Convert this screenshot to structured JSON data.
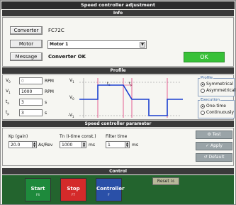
{
  "window": {
    "title": "Speed controller adjustment"
  },
  "info": {
    "header": "Info",
    "converter_button": "Converter",
    "converter_value": "FC72C",
    "motor_button": "Motor",
    "motor_value": "Motor 1",
    "message_button": "Message",
    "message_value": "Converter OK",
    "ok_label": "OK"
  },
  "profile": {
    "header": "Profile",
    "fields": [
      {
        "sym": "V",
        "sub": "0",
        "value": "0",
        "unit": "RPM"
      },
      {
        "sym": "V",
        "sub": "1",
        "value": "1000",
        "unit": "RPM"
      },
      {
        "sym": "t",
        "sub": "a",
        "value": "3",
        "unit": "s"
      },
      {
        "sym": "t",
        "sub": "p",
        "value": "3",
        "unit": "s"
      }
    ],
    "graph": {
      "v1_sym": "V",
      "v1_sub": "1",
      "v0_sym": "V",
      "v0_sub": "0",
      "negv1_sym": "-V",
      "negv1_sub": "1",
      "ta_sym": "t",
      "ta_sub": "a",
      "tp_sym": "t",
      "tp_sub": "p"
    },
    "profile_group": {
      "title": "Profile",
      "options": [
        "Symmetrical",
        "Asymmetrical"
      ],
      "selected": "Symmetrical"
    },
    "execution_group": {
      "title": "Execution",
      "options": [
        "One-time",
        "Continuously"
      ],
      "selected": "One-time"
    }
  },
  "controller": {
    "header": "Speed controller parameter",
    "kp_label": "Kp (gain)",
    "kp_value": "20.0",
    "kp_unit": "As/Rev",
    "tn_label": "Tn (I-time const.)",
    "tn_value": "1000",
    "tn_unit": "ms",
    "filter_label": "Filter time",
    "filter_value": "1",
    "filter_unit": "ms",
    "test_label": "Test",
    "apply_label": "Apply",
    "default_label": "Default"
  },
  "control": {
    "header": "Control",
    "start": {
      "label": "Start",
      "sub": "F4"
    },
    "stop": {
      "label": "Stop",
      "sub": "F7"
    },
    "controller": {
      "label": "Controller",
      "sub": "F"
    },
    "reset_label": "Reset",
    "reset_key": "F6"
  },
  "colors": {
    "ok_green": "#38c138",
    "start_green": "#1e8a3c",
    "stop_red": "#d42a2a",
    "controller_blue": "#2a50a8",
    "plot_blue": "#1a3fd0",
    "plot_pink": "#e03a7a"
  }
}
